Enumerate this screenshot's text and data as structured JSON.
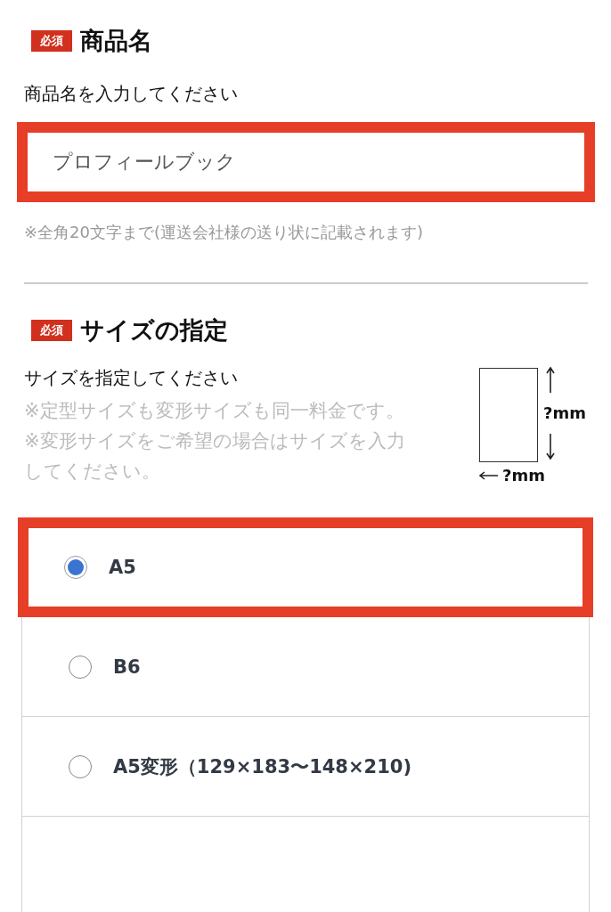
{
  "product_name": {
    "badge": "必須",
    "title": "商品名",
    "instruction": "商品名を入力してください",
    "field": {
      "value": "プロフィールブック",
      "highlighted": true
    },
    "note": "※全角20文字まで(運送会社様の送り状に記載されます)"
  },
  "size": {
    "badge": "必須",
    "title": "サイズの指定",
    "instruction": "サイズを指定してください",
    "notes": [
      "※定型サイズも変形サイズも同一料金です。",
      "※変形サイズをご希望の場合はサイズを入力してください。"
    ],
    "diagram": {
      "height_label": "?mm",
      "width_label": "?mm"
    },
    "options": [
      {
        "label": "A5",
        "selected": true,
        "highlighted": true
      },
      {
        "label": "B6",
        "selected": false,
        "highlighted": false
      },
      {
        "label": "A5変形（129×183〜148×210)",
        "selected": false,
        "highlighted": false
      }
    ]
  }
}
